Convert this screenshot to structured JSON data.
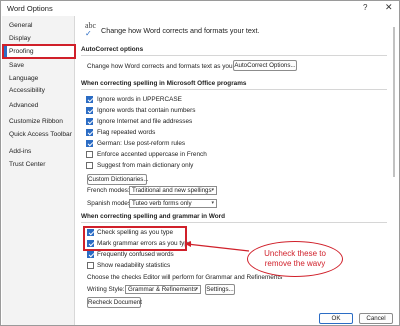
{
  "window": {
    "title": "Word Options",
    "help_glyph": "?",
    "close_glyph": "✕"
  },
  "sidebar": {
    "items": [
      {
        "label": "General"
      },
      {
        "label": "Display"
      },
      {
        "label": "Proofing"
      },
      {
        "label": "Save"
      },
      {
        "label": "Language"
      },
      {
        "label": "Accessibility"
      },
      {
        "label": "Advanced"
      },
      {
        "label": "Customize Ribbon"
      },
      {
        "label": "Quick Access Toolbar"
      },
      {
        "label": "Add-ins"
      },
      {
        "label": "Trust Center"
      }
    ],
    "selected": "Proofing"
  },
  "header": {
    "abc": "abc",
    "text": "Change how Word corrects and formats your text."
  },
  "autocorrect": {
    "title": "AutoCorrect options",
    "text": "Change how Word corrects and formats text as you type:",
    "button": "AutoCorrect Options..."
  },
  "office_spelling": {
    "title": "When correcting spelling in Microsoft Office programs",
    "options": [
      {
        "label": "Ignore words in UPPERCASE",
        "checked": true
      },
      {
        "label": "Ignore words that contain numbers",
        "checked": true
      },
      {
        "label": "Ignore Internet and file addresses",
        "checked": true
      },
      {
        "label": "Flag repeated words",
        "checked": true
      },
      {
        "label": "German: Use post-reform rules",
        "checked": true
      },
      {
        "label": "Enforce accented uppercase in French",
        "checked": false
      },
      {
        "label": "Suggest from main dictionary only",
        "checked": false
      }
    ],
    "custom_dict_button": "Custom Dictionaries...",
    "french_label": "French modes:",
    "french_value": "Traditional and new spellings",
    "spanish_label": "Spanish modes:",
    "spanish_value": "Tuteo verb forms only"
  },
  "word_spelling": {
    "title": "When correcting spelling and grammar in Word",
    "options": [
      {
        "label": "Check spelling as you type",
        "checked": true
      },
      {
        "label": "Mark grammar errors as you type",
        "checked": true
      },
      {
        "label": "Frequently confused words",
        "checked": true
      },
      {
        "label": "Show readability statistics",
        "checked": false
      }
    ],
    "choose_text": "Choose the checks Editor will perform for Grammar and Refinements",
    "writing_style_label": "Writing Style:",
    "writing_style_value": "Grammar & Refinements",
    "settings_button": "Settings...",
    "recheck_button": "Recheck Document"
  },
  "callout": {
    "text": "Uncheck these to remove the wavy"
  },
  "footer": {
    "ok": "OK",
    "cancel": "Cancel"
  },
  "colors": {
    "accent": "#2b6cc4",
    "annotation_red": "#d0202a"
  }
}
